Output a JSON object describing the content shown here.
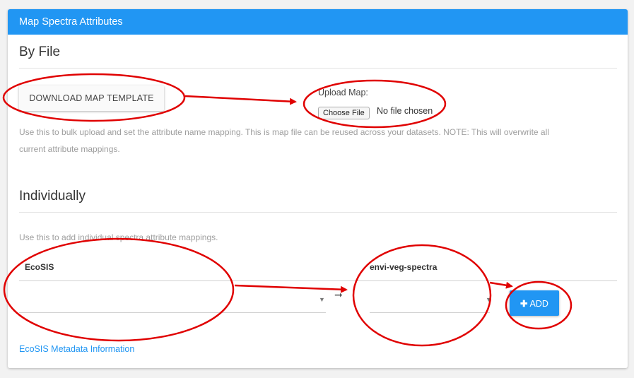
{
  "panel": {
    "title": "Map Spectra Attributes"
  },
  "by_file": {
    "heading": "By File",
    "download_button": "DOWNLOAD MAP TEMPLATE",
    "upload_label": "Upload Map:",
    "choose_file_button": "Choose File",
    "file_status": "No file chosen",
    "help_line1": "Use this to bulk upload and set the attribute name mapping. This is map file can be reused across your datasets. NOTE: This will overwrite all",
    "help_line2": "current attribute mappings."
  },
  "individually": {
    "heading": "Individually",
    "help": "Use this to add individual spectra attribute mappings.",
    "ecosis_label": "EcoSIS",
    "dataset_label": "envi-veg-spectra",
    "add_button": "ADD",
    "metadata_link": "EcoSIS Metadata Information"
  },
  "colors": {
    "accent": "#2196f3",
    "annotation": "#e00000"
  },
  "icons": {
    "add": "plus-icon",
    "select": "caret-down-icon",
    "mapping": "arrow-right-icon"
  }
}
